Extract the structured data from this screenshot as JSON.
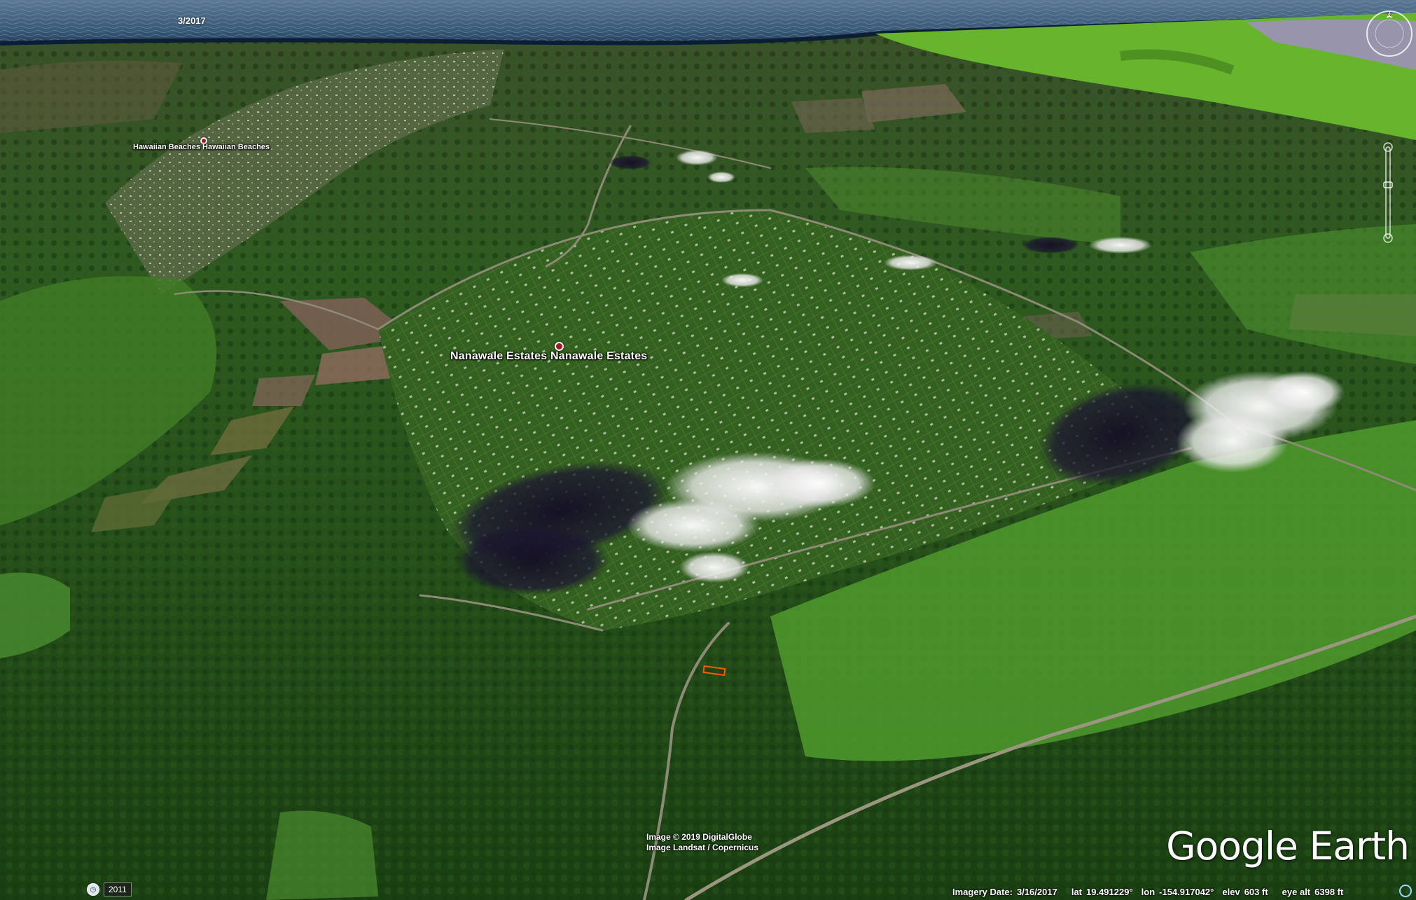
{
  "map": {
    "timestamp_label": "3/2017",
    "places": [
      {
        "name": "Hawaiian Beaches",
        "label": "Hawaiian Beaches  Hawaiian Beaches"
      },
      {
        "name": "Nanawale Estates",
        "label": "Nanawale Estates  Nanawale Estates"
      }
    ],
    "attribution": {
      "line1": "Image © 2019 DigitalGlobe",
      "line2": "Image Landsat / Copernicus"
    },
    "logo": "Google Earth",
    "historical_imagery_year": "2011"
  },
  "status_bar": {
    "imagery_date_label": "Imagery Date:",
    "imagery_date": "3/16/2017",
    "lat_label": "lat",
    "lat": "19.491229°",
    "lon_label": "lon",
    "lon": "-154.917042°",
    "elev_label": "elev",
    "elev": "603 ft",
    "eye_alt_label": "eye alt",
    "eye_alt": "6398 ft"
  },
  "controls": {
    "compass_icon": "compass-icon",
    "zoom_icon": "zoom-slider-icon",
    "clock_icon": "clock-icon",
    "status_icon": "streaming-status-icon"
  },
  "colors": {
    "ocean": "#3d5d7a",
    "forest": "#214d17",
    "pasture": "#4a8a2c",
    "highlight": "#ff5a00"
  }
}
